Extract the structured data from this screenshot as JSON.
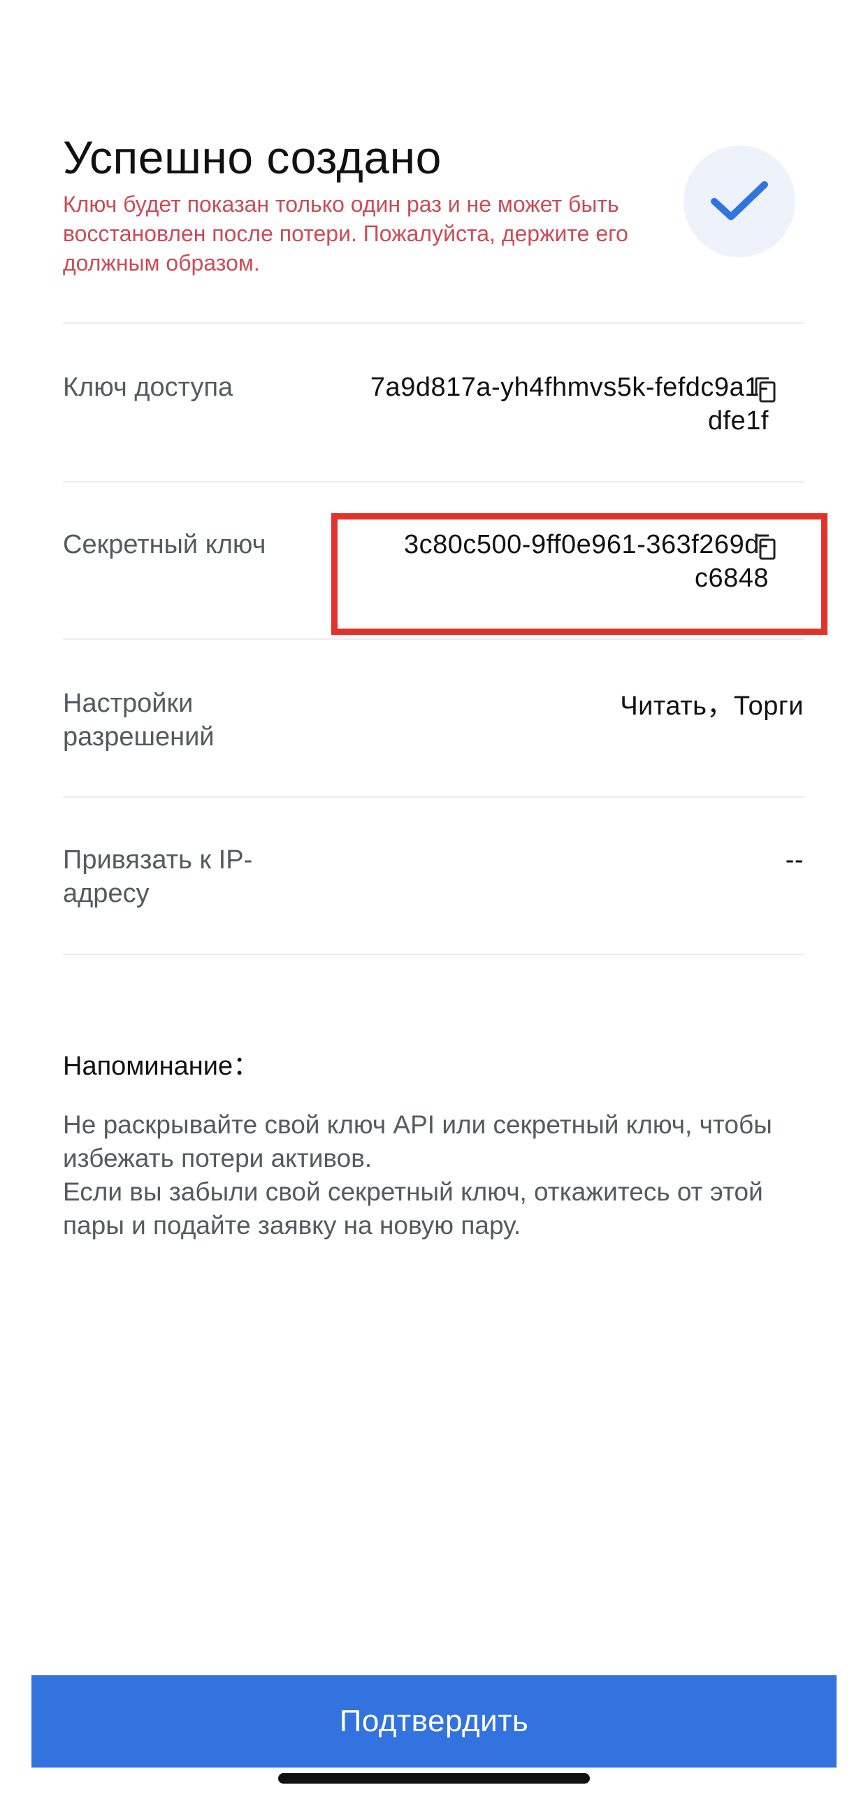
{
  "header": {
    "title": "Успешно создано",
    "warning": "Ключ будет показан только один раз и не может быть восстановлен после потери. Пожалуйста, держите его должным образом."
  },
  "rows": {
    "access_key": {
      "label": "Ключ доступа",
      "value_line1": "7a9d817a-yh4fhmvs5k-fefdc9a1-",
      "value_line2": "dfe1f"
    },
    "secret_key": {
      "label": "Секретный ключ",
      "value_line1": "3c80c500-9ff0e961-363f269d-",
      "value_line2": "c6848"
    },
    "permissions": {
      "label": "Настройки разрешений",
      "value": "Читать，Торги"
    },
    "ip_binding": {
      "label": "Привязать к IP-адресу",
      "value": "--"
    }
  },
  "reminder": {
    "title": "Напоминание：",
    "line1": "Не раскрывайте свой ключ API или секретный ключ, чтобы избежать потери активов.",
    "line2": "Если вы забыли свой секретный ключ, откажитесь от этой пары и подайте заявку на новую пару."
  },
  "confirm_button": {
    "label": "Подтвердить"
  },
  "colors": {
    "accent": "#3373e0",
    "warning": "#cc4b56",
    "highlight": "#e0332b",
    "check_bg": "#eef3fb"
  },
  "icons": {
    "check": "checkmark-icon",
    "copy": "copy-icon"
  }
}
